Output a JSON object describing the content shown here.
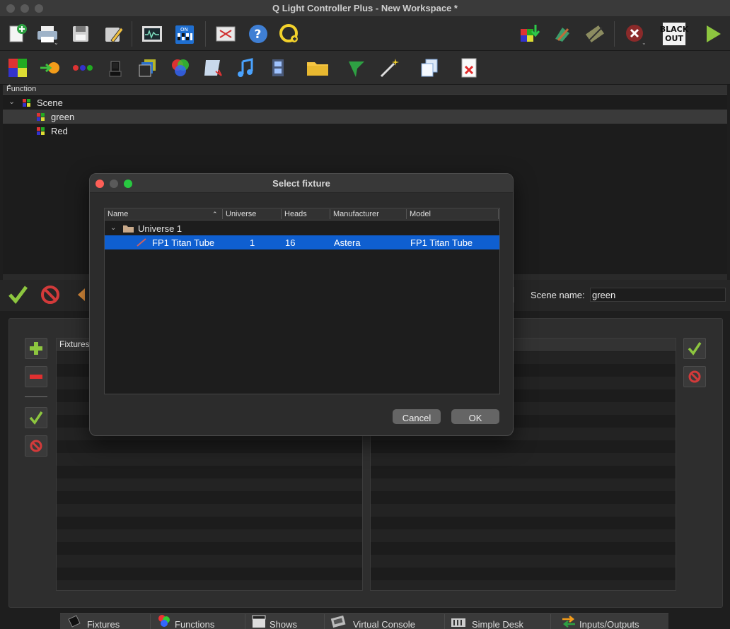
{
  "window": {
    "title": "Q Light Controller Plus - New Workspace *"
  },
  "function_panel": {
    "header": "Function",
    "tree": [
      {
        "label": "Scene",
        "children": [
          {
            "label": "green",
            "selected": true
          },
          {
            "label": "Red",
            "selected": false
          }
        ]
      }
    ]
  },
  "scene_editor": {
    "scene_name_label": "Scene name:",
    "scene_name_value": "green",
    "fixtures_list_header": "Fixtures"
  },
  "dialog": {
    "title": "Select fixture",
    "columns": {
      "name": "Name",
      "universe": "Universe",
      "heads": "Heads",
      "manufacturer": "Manufacturer",
      "model": "Model"
    },
    "group": {
      "label": "Universe 1"
    },
    "rows": [
      {
        "name": "FP1 Titan Tube",
        "universe": "1",
        "heads": "16",
        "manufacturer": "Astera",
        "model": "FP1 Titan Tube"
      }
    ],
    "cancel_label": "Cancel",
    "ok_label": "OK"
  },
  "toolbar": {
    "blackout_label_top": "BLACK",
    "blackout_label_bottom": "OUT"
  },
  "bottom_tabs": [
    {
      "label": "Fixtures"
    },
    {
      "label": "Functions"
    },
    {
      "label": "Shows"
    },
    {
      "label": "Virtual Console"
    },
    {
      "label": "Simple Desk"
    },
    {
      "label": "Inputs/Outputs"
    }
  ],
  "colors": {
    "selection": "#0f5fd0",
    "accent_green": "#8dc63f",
    "stop_red": "#c0392b"
  }
}
